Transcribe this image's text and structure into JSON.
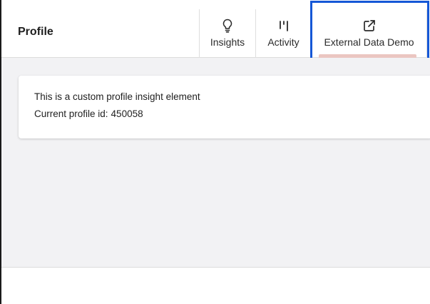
{
  "header": {
    "title": "Profile",
    "tabs": [
      {
        "label": "Insights",
        "icon": "lightbulb-icon"
      },
      {
        "label": "Activity",
        "icon": "activity-icon"
      },
      {
        "label": "External Data Demo",
        "icon": "external-link-icon",
        "active": true
      }
    ]
  },
  "card": {
    "line1": "This is a custom profile insight element",
    "line2_label": "Current profile id:",
    "profile_id": "450058"
  },
  "colors": {
    "highlight": "#1557d6",
    "active_tab_indicator": "#ebc6c1",
    "content_bg": "#f2f2f4"
  }
}
